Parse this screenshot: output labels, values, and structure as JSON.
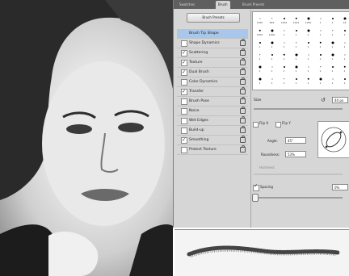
{
  "panel_tabs": [
    "Swatches",
    "Brush",
    "Brush Presets"
  ],
  "presets_button": "Brush Presets",
  "options": [
    {
      "label": "Brush Tip Shape",
      "checkbox": false,
      "selected": true,
      "lock": false
    },
    {
      "label": "Shape Dynamics",
      "checkbox": true,
      "checked": false,
      "lock": true
    },
    {
      "label": "Scattering",
      "checkbox": true,
      "checked": true,
      "lock": true
    },
    {
      "label": "Texture",
      "checkbox": true,
      "checked": true,
      "lock": true
    },
    {
      "label": "Dual Brush",
      "checkbox": true,
      "checked": true,
      "lock": true
    },
    {
      "label": "Color Dynamics",
      "checkbox": true,
      "checked": false,
      "lock": true
    },
    {
      "label": "Transfer",
      "checkbox": true,
      "checked": true,
      "lock": true
    },
    {
      "label": "Brush Pose",
      "checkbox": true,
      "checked": false,
      "lock": true
    },
    {
      "label": "Noise",
      "checkbox": true,
      "checked": false,
      "lock": true
    },
    {
      "label": "Wet Edges",
      "checkbox": true,
      "checked": false,
      "lock": true
    },
    {
      "label": "Build-up",
      "checkbox": true,
      "checked": false,
      "lock": true
    },
    {
      "label": "Smoothing",
      "checkbox": true,
      "checked": true,
      "lock": true
    },
    {
      "label": "Protect Texture",
      "checkbox": true,
      "checked": false,
      "lock": true
    }
  ],
  "brush_grid_numbers": [
    "1450",
    "826",
    "1032",
    "1001",
    "1250",
    "1",
    "1",
    "18",
    "1400",
    "1000",
    "1",
    "1",
    "1",
    "1",
    "1",
    "1",
    "1",
    "1",
    "1",
    "1",
    "1",
    "1",
    "1",
    "1",
    "1",
    "1",
    "1",
    "1",
    "1",
    "1",
    "1",
    "1",
    "1",
    "1",
    "1",
    "1",
    "1",
    "1",
    "1",
    "1",
    "1",
    "1",
    "1",
    "1",
    "1",
    "1",
    "1",
    "1"
  ],
  "size": {
    "label": "Size",
    "value": "40 px"
  },
  "flip_x": "Flip X",
  "flip_y": "Flip Y",
  "angle": {
    "label": "Angle:",
    "value": "45°"
  },
  "roundness": {
    "label": "Roundness:",
    "value": "53%"
  },
  "hardness": {
    "label": "Hardness"
  },
  "spacing": {
    "label": "Spacing",
    "value": "0%"
  }
}
